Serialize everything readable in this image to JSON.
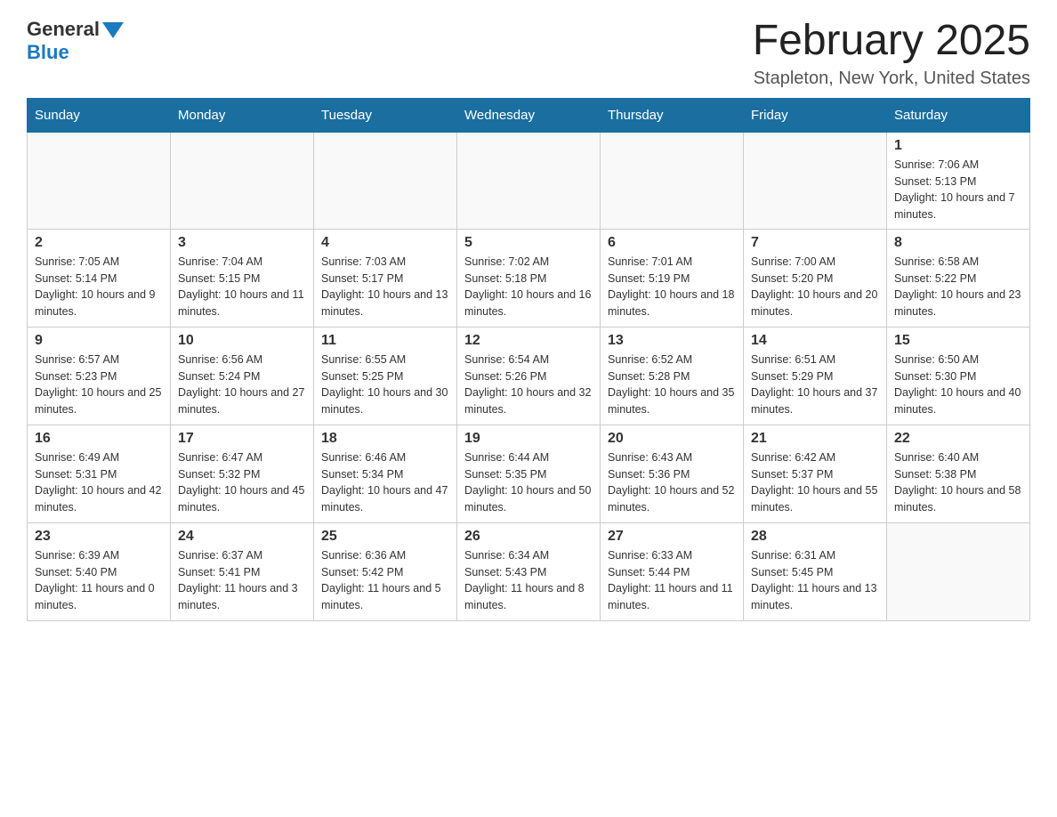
{
  "logo": {
    "general": "General",
    "blue": "Blue"
  },
  "title": {
    "month": "February 2025",
    "location": "Stapleton, New York, United States"
  },
  "days_of_week": [
    "Sunday",
    "Monday",
    "Tuesday",
    "Wednesday",
    "Thursday",
    "Friday",
    "Saturday"
  ],
  "weeks": [
    [
      {
        "day": "",
        "info": ""
      },
      {
        "day": "",
        "info": ""
      },
      {
        "day": "",
        "info": ""
      },
      {
        "day": "",
        "info": ""
      },
      {
        "day": "",
        "info": ""
      },
      {
        "day": "",
        "info": ""
      },
      {
        "day": "1",
        "info": "Sunrise: 7:06 AM\nSunset: 5:13 PM\nDaylight: 10 hours and 7 minutes."
      }
    ],
    [
      {
        "day": "2",
        "info": "Sunrise: 7:05 AM\nSunset: 5:14 PM\nDaylight: 10 hours and 9 minutes."
      },
      {
        "day": "3",
        "info": "Sunrise: 7:04 AM\nSunset: 5:15 PM\nDaylight: 10 hours and 11 minutes."
      },
      {
        "day": "4",
        "info": "Sunrise: 7:03 AM\nSunset: 5:17 PM\nDaylight: 10 hours and 13 minutes."
      },
      {
        "day": "5",
        "info": "Sunrise: 7:02 AM\nSunset: 5:18 PM\nDaylight: 10 hours and 16 minutes."
      },
      {
        "day": "6",
        "info": "Sunrise: 7:01 AM\nSunset: 5:19 PM\nDaylight: 10 hours and 18 minutes."
      },
      {
        "day": "7",
        "info": "Sunrise: 7:00 AM\nSunset: 5:20 PM\nDaylight: 10 hours and 20 minutes."
      },
      {
        "day": "8",
        "info": "Sunrise: 6:58 AM\nSunset: 5:22 PM\nDaylight: 10 hours and 23 minutes."
      }
    ],
    [
      {
        "day": "9",
        "info": "Sunrise: 6:57 AM\nSunset: 5:23 PM\nDaylight: 10 hours and 25 minutes."
      },
      {
        "day": "10",
        "info": "Sunrise: 6:56 AM\nSunset: 5:24 PM\nDaylight: 10 hours and 27 minutes."
      },
      {
        "day": "11",
        "info": "Sunrise: 6:55 AM\nSunset: 5:25 PM\nDaylight: 10 hours and 30 minutes."
      },
      {
        "day": "12",
        "info": "Sunrise: 6:54 AM\nSunset: 5:26 PM\nDaylight: 10 hours and 32 minutes."
      },
      {
        "day": "13",
        "info": "Sunrise: 6:52 AM\nSunset: 5:28 PM\nDaylight: 10 hours and 35 minutes."
      },
      {
        "day": "14",
        "info": "Sunrise: 6:51 AM\nSunset: 5:29 PM\nDaylight: 10 hours and 37 minutes."
      },
      {
        "day": "15",
        "info": "Sunrise: 6:50 AM\nSunset: 5:30 PM\nDaylight: 10 hours and 40 minutes."
      }
    ],
    [
      {
        "day": "16",
        "info": "Sunrise: 6:49 AM\nSunset: 5:31 PM\nDaylight: 10 hours and 42 minutes."
      },
      {
        "day": "17",
        "info": "Sunrise: 6:47 AM\nSunset: 5:32 PM\nDaylight: 10 hours and 45 minutes."
      },
      {
        "day": "18",
        "info": "Sunrise: 6:46 AM\nSunset: 5:34 PM\nDaylight: 10 hours and 47 minutes."
      },
      {
        "day": "19",
        "info": "Sunrise: 6:44 AM\nSunset: 5:35 PM\nDaylight: 10 hours and 50 minutes."
      },
      {
        "day": "20",
        "info": "Sunrise: 6:43 AM\nSunset: 5:36 PM\nDaylight: 10 hours and 52 minutes."
      },
      {
        "day": "21",
        "info": "Sunrise: 6:42 AM\nSunset: 5:37 PM\nDaylight: 10 hours and 55 minutes."
      },
      {
        "day": "22",
        "info": "Sunrise: 6:40 AM\nSunset: 5:38 PM\nDaylight: 10 hours and 58 minutes."
      }
    ],
    [
      {
        "day": "23",
        "info": "Sunrise: 6:39 AM\nSunset: 5:40 PM\nDaylight: 11 hours and 0 minutes."
      },
      {
        "day": "24",
        "info": "Sunrise: 6:37 AM\nSunset: 5:41 PM\nDaylight: 11 hours and 3 minutes."
      },
      {
        "day": "25",
        "info": "Sunrise: 6:36 AM\nSunset: 5:42 PM\nDaylight: 11 hours and 5 minutes."
      },
      {
        "day": "26",
        "info": "Sunrise: 6:34 AM\nSunset: 5:43 PM\nDaylight: 11 hours and 8 minutes."
      },
      {
        "day": "27",
        "info": "Sunrise: 6:33 AM\nSunset: 5:44 PM\nDaylight: 11 hours and 11 minutes."
      },
      {
        "day": "28",
        "info": "Sunrise: 6:31 AM\nSunset: 5:45 PM\nDaylight: 11 hours and 13 minutes."
      },
      {
        "day": "",
        "info": ""
      }
    ]
  ]
}
